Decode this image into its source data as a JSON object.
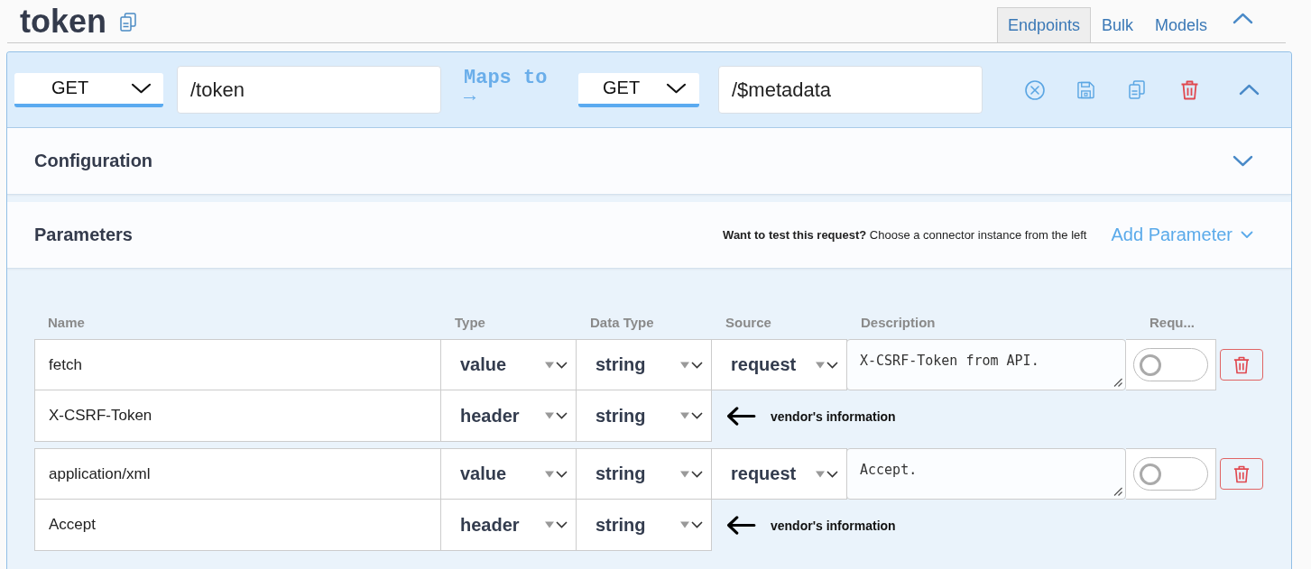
{
  "header": {
    "title": "token",
    "tabs": [
      {
        "label": "Endpoints",
        "selected": true
      },
      {
        "label": "Bulk",
        "selected": false
      },
      {
        "label": "Models",
        "selected": false
      }
    ],
    "expanded": true
  },
  "endpoint": {
    "method": "GET",
    "path": "/token",
    "maps_to": "Maps to →",
    "target_method": "GET",
    "target_path": "/$metadata",
    "expanded": true
  },
  "configuration": {
    "title": "Configuration",
    "expanded": false
  },
  "parameters": {
    "title": "Parameters",
    "hint": "**Want to test this request?** Choose a connector instance from the left",
    "add_button": "Add Parameter",
    "columns": [
      "Name",
      "Type",
      "Data Type",
      "Source",
      "Description",
      "Requ..."
    ],
    "items": [
      {
        "value": {
          "name": "fetch",
          "type": "value",
          "data_type": "string",
          "source": "request",
          "description": "X-CSRF-Token from API.",
          "required": false
        },
        "header": {
          "name": "X-CSRF-Token",
          "type": "header",
          "data_type": "string",
          "note": "vendor's information"
        }
      },
      {
        "value": {
          "name": "application/xml",
          "type": "value",
          "data_type": "string",
          "source": "request",
          "description": "Accept.",
          "required": false
        },
        "header": {
          "name": "Accept",
          "type": "header",
          "data_type": "string",
          "note": "vendor's information"
        }
      }
    ]
  }
}
